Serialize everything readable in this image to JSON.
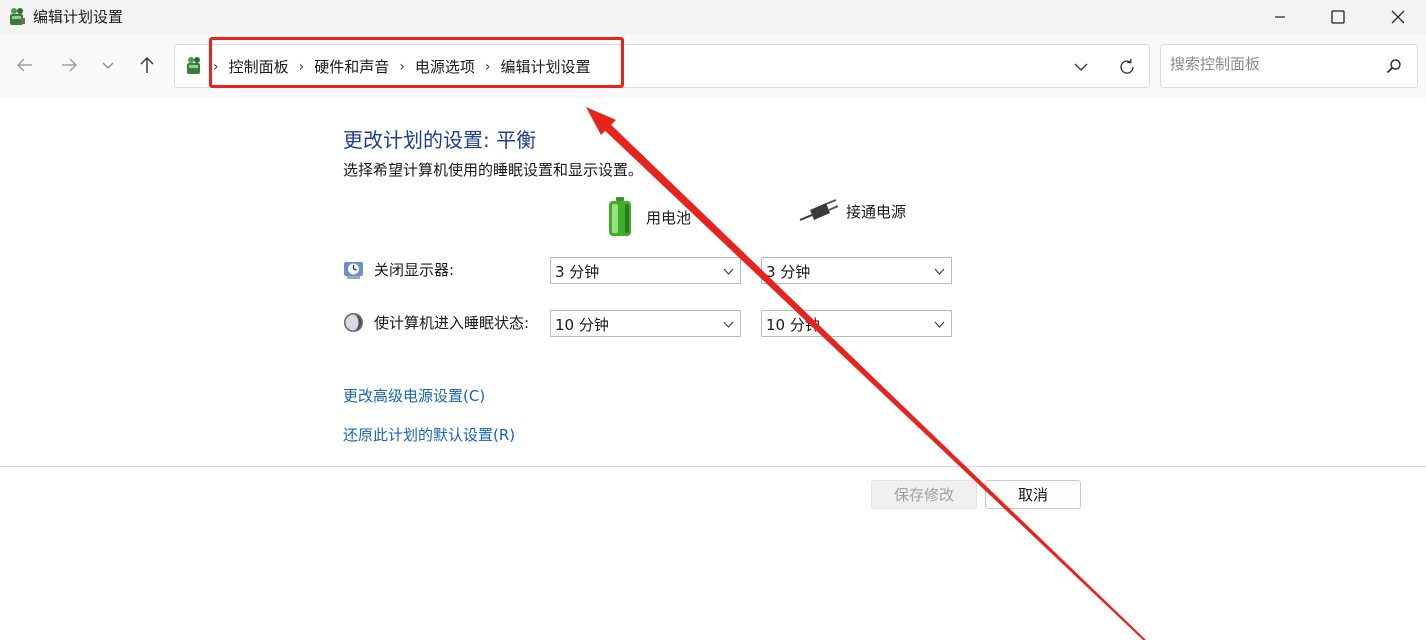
{
  "window": {
    "title": "编辑计划设置",
    "minimize_icon": "minimize-icon",
    "maximize_icon": "maximize-icon",
    "close_icon": "close-icon"
  },
  "nav": {
    "back_icon": "arrow-left-icon",
    "forward_icon": "arrow-right-icon",
    "recent_icon": "chevron-down-icon",
    "up_icon": "arrow-up-icon",
    "breadcrumb": [
      "控制面板",
      "硬件和声音",
      "电源选项",
      "编辑计划设置"
    ],
    "separator": "›",
    "search_placeholder": "搜索控制面板"
  },
  "main": {
    "heading": "更改计划的设置: 平衡",
    "subheading": "选择希望计算机使用的睡眠设置和显示设置。",
    "columns": {
      "battery": "用电池",
      "plugged": "接通电源"
    },
    "rows": [
      {
        "label": "关闭显示器:",
        "battery_value": "3 分钟",
        "plugged_value": "3 分钟"
      },
      {
        "label": "使计算机进入睡眠状态:",
        "battery_value": "10 分钟",
        "plugged_value": "10 分钟"
      }
    ],
    "links": {
      "advanced": "更改高级电源设置(C)",
      "restore": "还原此计划的默认设置(R)"
    }
  },
  "footer": {
    "save_label": "保存修改",
    "cancel_label": "取消"
  },
  "colors": {
    "heading": "#1e3f91",
    "link": "#1764b6",
    "annotation": "#e8231d"
  }
}
